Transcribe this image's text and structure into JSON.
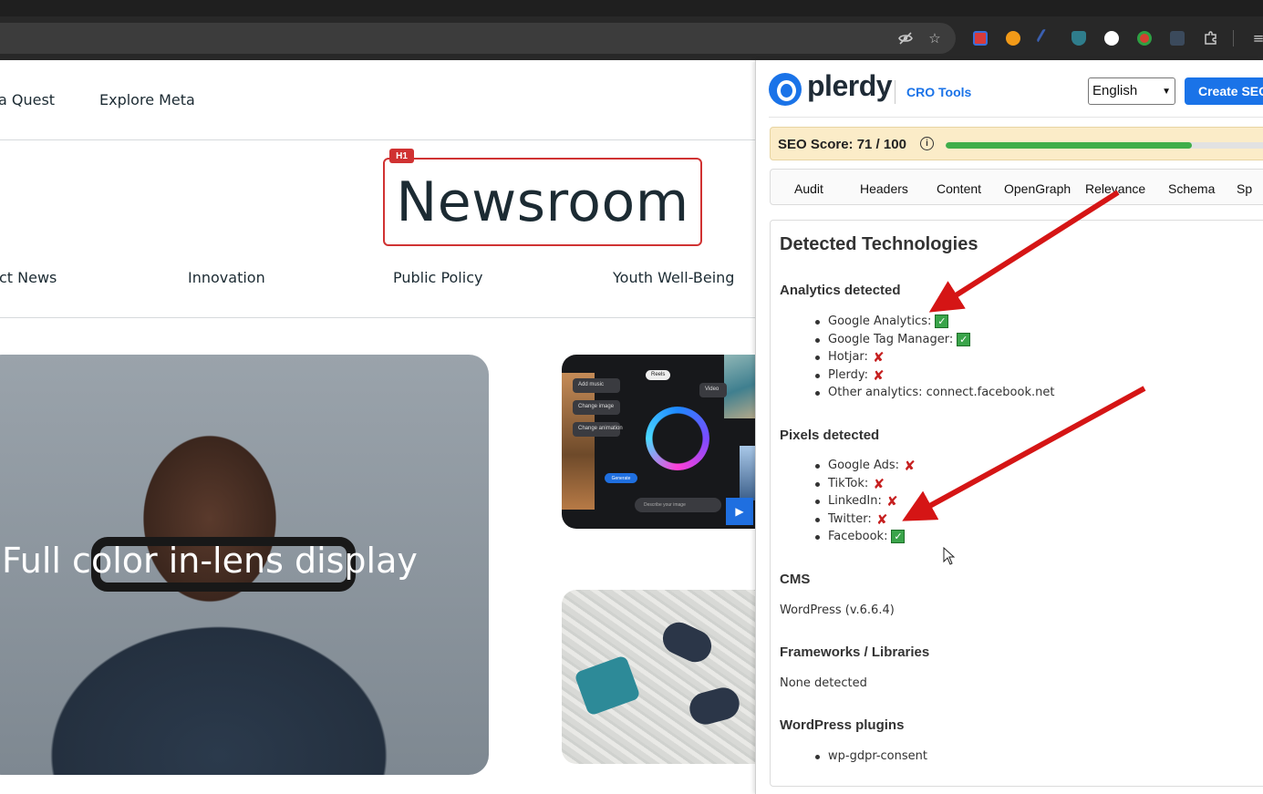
{
  "browser": {
    "icons": [
      "eye-off-icon",
      "star-icon",
      "extension-puzzle-icon",
      "reading-list-icon"
    ]
  },
  "site": {
    "nav": [
      "a Quest",
      "Explore Meta"
    ],
    "h1_tag": "H1",
    "title": "Newsroom",
    "categories": [
      "ct News",
      "Innovation",
      "Public Policy",
      "Youth Well-Being"
    ],
    "hero_caption": "Full color in-lens display",
    "card1": {
      "pills": [
        "Add music",
        "Change image",
        "Change animation"
      ],
      "top_chip": "Reels",
      "video_chip": "Video",
      "generate": "Generate",
      "prompt": "Describe your image"
    }
  },
  "plerdy": {
    "brand": "plerdy",
    "cro_tools": "CRO Tools",
    "language": "English",
    "create_button": "Create SEO",
    "seo_score_label": "SEO Score: 71 / 100",
    "seo_score": 71,
    "seo_max": 100,
    "tabs": [
      "Audit",
      "Headers",
      "Content",
      "OpenGraph",
      "Relevance",
      "Schema",
      "Sp"
    ],
    "section_title": "Detected Technologies",
    "analytics": {
      "heading": "Analytics detected",
      "items": [
        {
          "label": "Google Analytics:",
          "status": "ok"
        },
        {
          "label": "Google Tag Manager:",
          "status": "ok"
        },
        {
          "label": "Hotjar:",
          "status": "no"
        },
        {
          "label": "Plerdy:",
          "status": "no"
        },
        {
          "label": "Other analytics: connect.facebook.net",
          "status": ""
        }
      ]
    },
    "pixels": {
      "heading": "Pixels detected",
      "items": [
        {
          "label": "Google Ads:",
          "status": "no"
        },
        {
          "label": "TikTok:",
          "status": "no"
        },
        {
          "label": "LinkedIn:",
          "status": "no"
        },
        {
          "label": "Twitter:",
          "status": "no"
        },
        {
          "label": "Facebook:",
          "status": "ok"
        }
      ]
    },
    "cms": {
      "heading": "CMS",
      "value": "WordPress (v.6.6.4)"
    },
    "frameworks": {
      "heading": "Frameworks / Libraries",
      "value": "None detected"
    },
    "plugins": {
      "heading": "WordPress plugins",
      "items": [
        "wp-gdpr-consent"
      ]
    }
  },
  "colors": {
    "accent": "#1a73e8",
    "annotation_arrow": "#d51515",
    "score_bar": "#3fae49",
    "ok": "#3aa44a",
    "no": "#c62020"
  }
}
